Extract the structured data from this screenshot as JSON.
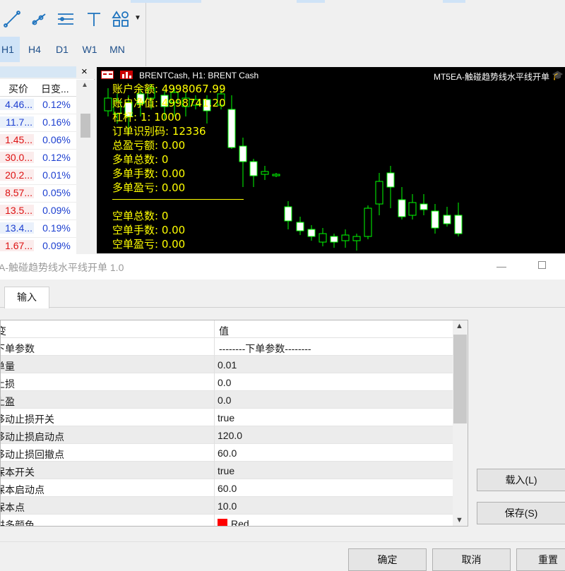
{
  "toolbar": {
    "icons": [
      "trendline-icon",
      "ray-icon",
      "channel-icon",
      "text-icon",
      "shapes-icon"
    ],
    "dropdown_icon": "chevron-down-icon"
  },
  "timeframes": [
    {
      "label": "H1",
      "active": true
    },
    {
      "label": "H4",
      "active": false
    },
    {
      "label": "D1",
      "active": false
    },
    {
      "label": "W1",
      "active": false
    },
    {
      "label": "MN",
      "active": false
    }
  ],
  "market_watch": {
    "close_label": "×",
    "columns": [
      "买价",
      "日变..."
    ],
    "rows": [
      {
        "bid": "4.46...",
        "change": "0.12%",
        "dir": "up"
      },
      {
        "bid": "11.7...",
        "change": "0.16%",
        "dir": "up"
      },
      {
        "bid": "1.45...",
        "change": "0.06%",
        "dir": "down"
      },
      {
        "bid": "30.0...",
        "change": "0.12%",
        "dir": "down"
      },
      {
        "bid": "20.2...",
        "change": "0.01%",
        "dir": "down"
      },
      {
        "bid": "8.57...",
        "change": "0.05%",
        "dir": "down"
      },
      {
        "bid": "13.5...",
        "change": "0.09%",
        "dir": "down"
      },
      {
        "bid": "13.4...",
        "change": "0.19%",
        "dir": "up"
      },
      {
        "bid": "1.67...",
        "change": "0.09%",
        "dir": "down"
      }
    ]
  },
  "chart": {
    "title": "BRENTCash, H1:  BRENT Cash",
    "ea_name": "MT5EA-触碰趋势线水平线开单",
    "ea_icon": "graduation-cap-icon",
    "info_lines": [
      "账户余额: 4998067.99",
      "账户净值: 4998741.20",
      "杠杆: 1: 1000",
      "订单识别码: 12336",
      "总盈亏额: 0.00",
      "多单总数: 0",
      "多单手数: 0.00",
      "多单盈亏: 0.00",
      "空单总数: 0",
      "空单手数: 0.00",
      "空单盈亏: 0.00"
    ],
    "colors": {
      "bull": "#00ff00",
      "bear_body": "#ffffff",
      "text": "#ffff00",
      "bg": "#000000"
    }
  },
  "dialog": {
    "title": "A-触碰趋势线水平线开单 1.0",
    "tab": "输入",
    "columns": [
      "变",
      "值"
    ],
    "params": [
      {
        "key": "下单参数",
        "value": "--------下单参数--------",
        "group": true
      },
      {
        "key": "单量",
        "value": "0.01"
      },
      {
        "key": "止损",
        "value": "0.0"
      },
      {
        "key": "止盈",
        "value": "0.0"
      },
      {
        "key": "移动止损开关",
        "value": "true"
      },
      {
        "key": "移动止损启动点",
        "value": "120.0"
      },
      {
        "key": "移动止损回撤点",
        "value": "60.0"
      },
      {
        "key": "保本开关",
        "value": "true"
      },
      {
        "key": "保本启动点",
        "value": "60.0"
      },
      {
        "key": "保本点",
        "value": "10.0"
      },
      {
        "key": "讲多颜色",
        "value": "Red",
        "swatch": "#ff0000"
      }
    ],
    "buttons": {
      "load": "载入(L)",
      "save": "保存(S)",
      "ok": "确定",
      "cancel": "取消",
      "reset": "重置"
    }
  }
}
